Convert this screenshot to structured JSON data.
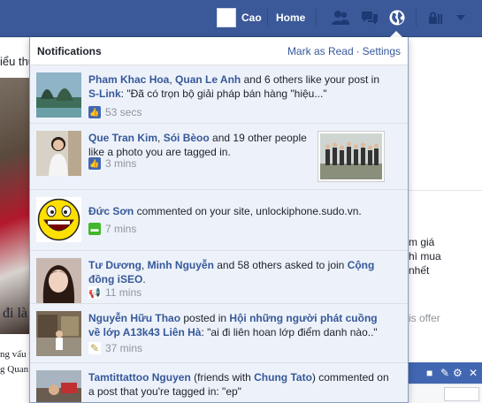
{
  "topbar": {
    "user_name": "Cao",
    "home_label": "Home",
    "icons": [
      "friends-icon",
      "messages-icon",
      "globe-notifications-icon",
      "privacy-lock-icon",
      "chevron-down-icon"
    ]
  },
  "background": {
    "left_text_1": "iểu thu",
    "left_text_2": "đi là",
    "left_text_3": "ng vấu t",
    "left_text_4": "g Quan",
    "right_text_1": "m giá",
    "right_text_2": "hì mua",
    "right_text_3": "nhết",
    "right_offer": "is offer"
  },
  "notifications": {
    "title": "Notifications",
    "mark_as_read": "Mark as Read",
    "separator": "·",
    "settings": "Settings",
    "items": [
      {
        "actor_1": "Pham Khac Hoa",
        "joiner": ", ",
        "actor_2": "Quan Le Anh",
        "text_1": " and 6 others like your post in ",
        "target": "S-Link",
        "text_2": ": \"Đã có trọn bộ giải pháp bán hàng \"hiệu...\"",
        "time": "53 secs",
        "type_icon": "like-icon"
      },
      {
        "actor_1": "Que Tran Kim",
        "joiner": ", ",
        "actor_2": "Sói Bèoo",
        "text_1": " and 19 other people like a photo you are tagged in.",
        "time": "3 mins",
        "type_icon": "like-icon"
      },
      {
        "actor_1": "Đức Sơn",
        "text_1": " commented on your site, unlockiphone.sudo.vn.",
        "time": "7 mins",
        "type_icon": "comment-icon"
      },
      {
        "actor_1": "Tư Dương",
        "joiner": ", ",
        "actor_2": "Minh Nguyễn",
        "text_1": " and 58 others asked to join ",
        "target": "Cộng đồng iSEO",
        "text_2": ".",
        "time": "11 mins",
        "type_icon": "megaphone-icon"
      },
      {
        "actor_1": "Nguyễn Hữu Thao",
        "text_1": " posted in ",
        "target": "Hội những người phát cuồng về lớp A13k43 Liên Hà",
        "text_2": ": \"ai đi liên hoan lớp điểm danh nào..\"",
        "time": "37 mins",
        "type_icon": "pencil-icon"
      },
      {
        "actor_1": "Tamtittattoo Nguyen",
        "text_1": " (friends with ",
        "actor_2": "Chung Tato",
        "text_2": ") commented on a post that you're tagged in: \"ep\"",
        "type_icon": "comment-icon"
      }
    ]
  },
  "colors": {
    "topbar": "#3b5998",
    "link": "#365899",
    "unread_row": "#edf2fa"
  }
}
